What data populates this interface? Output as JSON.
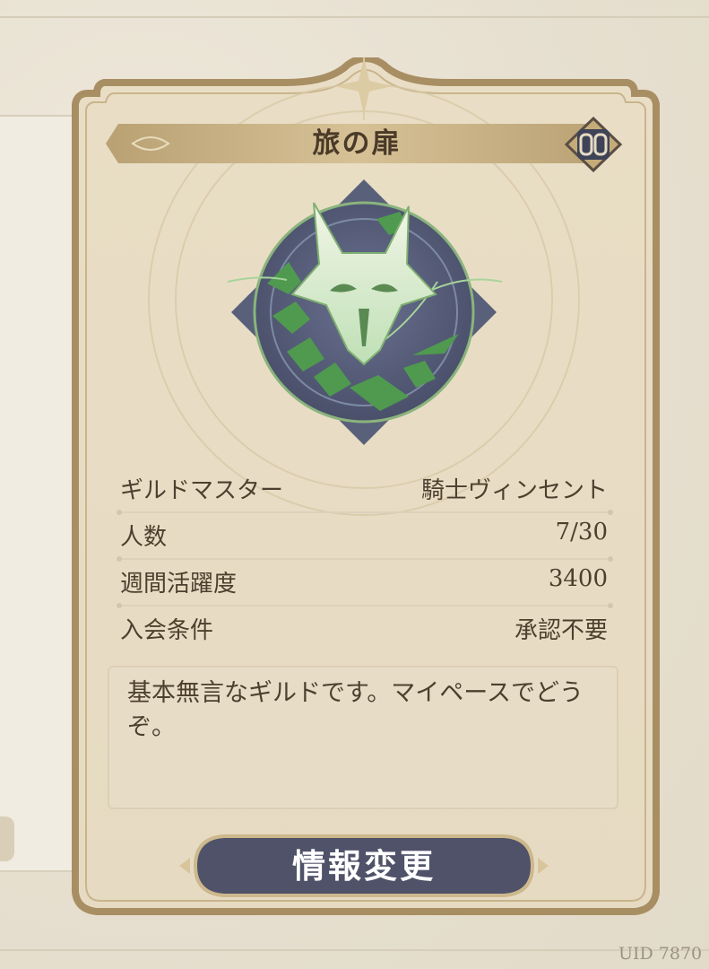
{
  "guild": {
    "name": "旅の扉",
    "info": [
      {
        "key": "ギルドマスター",
        "value": "騎士ヴィンセント"
      },
      {
        "key": "人数",
        "value": "7/30"
      },
      {
        "key": "週間活躍度",
        "value": "3400"
      },
      {
        "key": "入会条件",
        "value": "承認不要"
      }
    ],
    "description": "基本無言なギルドです。マイペースでどうぞ。"
  },
  "actions": {
    "edit_label": "情報変更"
  },
  "footer": {
    "uid": "UID 7870"
  },
  "icons": {
    "chain": "chain-link-icon",
    "emblem": "fox-mask-emblem"
  },
  "colors": {
    "parchment": "#eadfc6",
    "frame": "#a88e63",
    "button": "#4f5268",
    "emblem_green": "#5fa35c"
  }
}
